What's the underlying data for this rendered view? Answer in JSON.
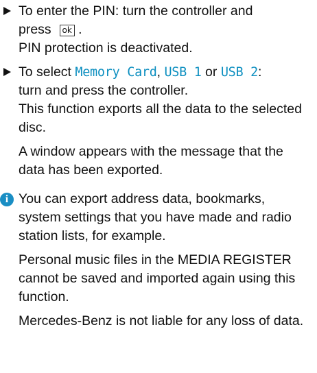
{
  "steps": [
    {
      "line1_text": "To enter the PIN: turn the controller and",
      "line2_text": "press",
      "key_label": "ok",
      "line2_end": ".",
      "result": "PIN protection is deactivated."
    },
    {
      "prefix": "To select ",
      "option1": "Memory Card",
      "sep1": ", ",
      "option2": "USB 1",
      "sep2": " or ",
      "option3": "USB 2",
      "suffix": ":",
      "line2": "turn and press the controller.",
      "result": "This function exports all the data to the selected disc.",
      "result2": "A window appears with the message that the data has been exported."
    }
  ],
  "info": {
    "icon": "info-icon",
    "icon_glyph": "i",
    "paragraphs": [
      "You can export address data, bookmarks, system settings that you have made and radio station lists, for example.",
      "Personal music files in the MEDIA REGISTER cannot be saved and imported again using this function.",
      "Mercedes-Benz is not liable for any loss of data."
    ]
  },
  "colors": {
    "menu_text": "#0d8fc0",
    "info_icon": "#1a8ec4",
    "text": "#111111"
  }
}
